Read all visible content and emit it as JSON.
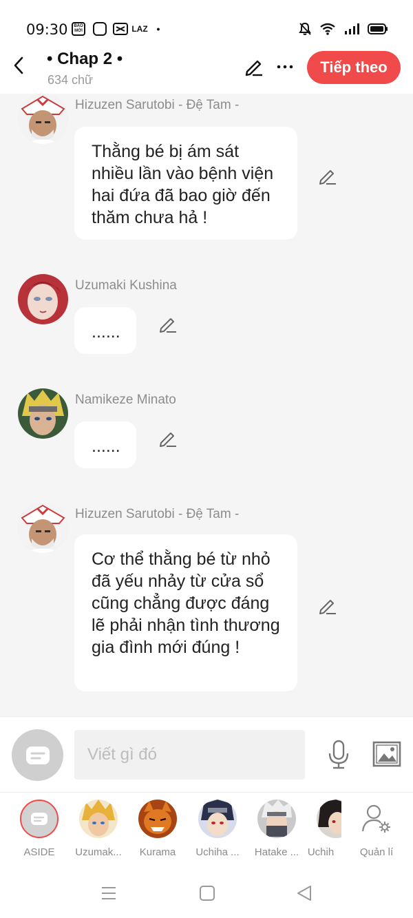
{
  "status": {
    "time": "09:30",
    "baomoi_label": "BÁO MỚI",
    "laz_label": "LAZ",
    "dot": "•"
  },
  "header": {
    "title": "• Chap 2 •",
    "word_count": "634 chữ",
    "next_label": "Tiếp theo",
    "accent": "#f04a4a"
  },
  "messages": [
    {
      "name": "Hizuzen Sarutobi - Đệ Tam -",
      "text": "Thằng bé bị ám sát nhiều lần vào bệnh viện hai đứa đã bao giờ đến thăm chưa hả !",
      "avatar": "sarutobi-avatar"
    },
    {
      "name": "Uzumaki Kushina",
      "text": "......",
      "avatar": "kushina-avatar"
    },
    {
      "name": "Namikeze Minato",
      "text": "......",
      "avatar": "minato-avatar"
    },
    {
      "name": "Hizuzen Sarutobi - Đệ Tam -",
      "text": "Cơ thể thằng bé từ nhỏ đã yếu nhảy từ cửa sổ cũng chẳng được đáng lẽ phải nhận tình thương gia đình mới đúng !",
      "avatar": "sarutobi-avatar"
    }
  ],
  "composer": {
    "placeholder": "Viết gì đó"
  },
  "characters": [
    {
      "label": "ASIDE"
    },
    {
      "label": "Uzumak..."
    },
    {
      "label": "Kurama"
    },
    {
      "label": "Uchiha ..."
    },
    {
      "label": "Hatake ..."
    },
    {
      "label": "Uchih"
    },
    {
      "label": "Quản lí"
    }
  ]
}
